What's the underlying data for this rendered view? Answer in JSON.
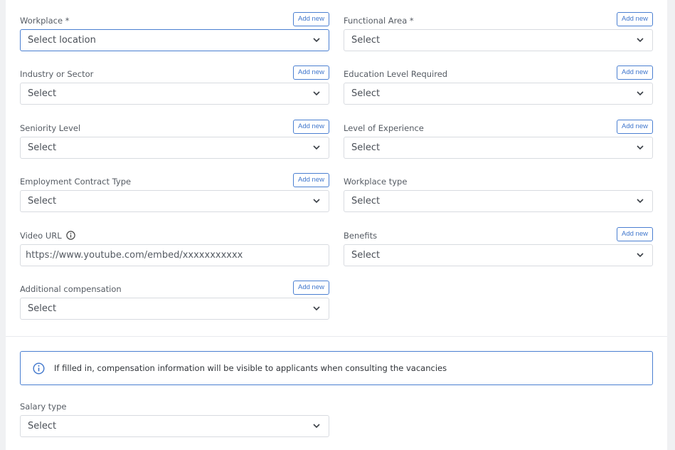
{
  "fields": {
    "workplace": {
      "label": "Workplace *",
      "value": "Select location",
      "add": "Add new"
    },
    "functional_area": {
      "label": "Functional Area *",
      "value": "Select",
      "add": "Add new"
    },
    "industry": {
      "label": "Industry or Sector",
      "value": "Select",
      "add": "Add new"
    },
    "education": {
      "label": "Education Level Required",
      "value": "Select",
      "add": "Add new"
    },
    "seniority": {
      "label": "Seniority Level",
      "value": "Select",
      "add": "Add new"
    },
    "experience": {
      "label": "Level of Experience",
      "value": "Select",
      "add": "Add new"
    },
    "contract": {
      "label": "Employment Contract Type",
      "value": "Select",
      "add": "Add new"
    },
    "workplace_type": {
      "label": "Workplace type",
      "value": "Select"
    },
    "video_url": {
      "label": "Video URL",
      "value": "https://www.youtube.com/embed/xxxxxxxxxxx"
    },
    "benefits": {
      "label": "Benefits",
      "value": "Select",
      "add": "Add new"
    },
    "additional_comp": {
      "label": "Additional compensation",
      "value": "Select",
      "add": "Add new"
    },
    "salary_type": {
      "label": "Salary type",
      "value": "Select"
    }
  },
  "alert": {
    "message": "If filled in, compensation information will be visible to applicants when consulting the vacancies"
  },
  "icons": {
    "chevron": "chevron-down-icon",
    "info": "info-icon"
  },
  "colors": {
    "accent": "#4a7fd1",
    "border": "#d8dbe0",
    "text": "#4a4f57"
  }
}
